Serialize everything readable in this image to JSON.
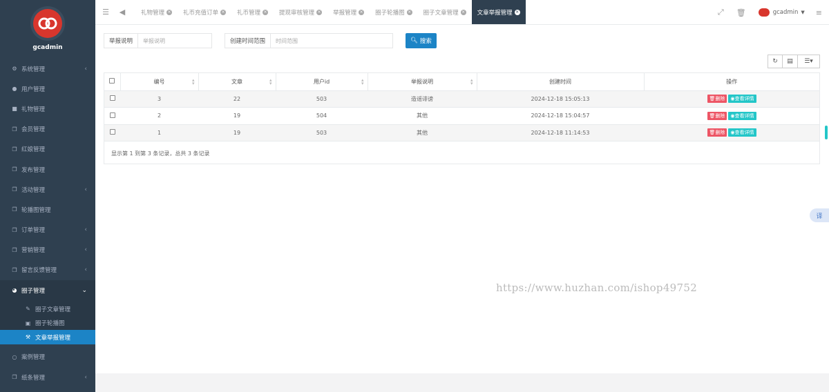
{
  "brand": {
    "name": "gcadmin"
  },
  "sidebar": {
    "items": [
      {
        "label": "系统管理",
        "icon": "gears-icon",
        "arrow": "‹"
      },
      {
        "label": "用户管理",
        "icon": "user-icon",
        "arrow": ""
      },
      {
        "label": "礼物管理",
        "icon": "gift-icon",
        "arrow": ""
      },
      {
        "label": "会员管理",
        "icon": "copy-icon",
        "arrow": ""
      },
      {
        "label": "红娘管理",
        "icon": "copy-icon",
        "arrow": ""
      },
      {
        "label": "发布管理",
        "icon": "copy-icon",
        "arrow": ""
      },
      {
        "label": "活动管理",
        "icon": "copy-icon",
        "arrow": "‹"
      },
      {
        "label": "轮播图管理",
        "icon": "copy-icon",
        "arrow": ""
      },
      {
        "label": "订单管理",
        "icon": "copy-icon",
        "arrow": "‹"
      },
      {
        "label": "营销管理",
        "icon": "copy-icon",
        "arrow": "‹"
      },
      {
        "label": "留言反馈管理",
        "icon": "copy-icon",
        "arrow": "‹"
      }
    ],
    "open_group": {
      "label": "圈子管理",
      "icon": "pie-chart-icon",
      "arrow": "⌄"
    },
    "sub_items": [
      {
        "label": "圈子文章管理",
        "icon": "edit-icon"
      },
      {
        "label": "圈子轮播图",
        "icon": "image-icon"
      },
      {
        "label": "文章举报管理",
        "icon": "gavel-icon"
      }
    ],
    "after_items": [
      {
        "label": "案例管理",
        "icon": "circle-icon",
        "arrow": ""
      },
      {
        "label": "纸条管理",
        "icon": "copy-icon",
        "arrow": "‹"
      }
    ]
  },
  "topbar": {
    "tabs": [
      "礼物管理",
      "礼币充值订单",
      "礼币管理",
      "提现审核管理",
      "举报管理",
      "圈子轮播图",
      "圈子文章管理"
    ],
    "active_tab": "文章举报管理",
    "user_name": "gcadmin"
  },
  "search": {
    "field1_label": "举报说明",
    "field1_placeholder": "举报说明",
    "field2_label": "创建时间范围",
    "field2_placeholder": "时间范围",
    "button_label": "搜索"
  },
  "table": {
    "headers": [
      "编号",
      "文章",
      "用户id",
      "举报说明",
      "创建时间",
      "操作"
    ],
    "rows": [
      {
        "id": "3",
        "article": "22",
        "user_id": "503",
        "reason": "造谣诽谤",
        "created": "2024-12-18 15:05:13"
      },
      {
        "id": "2",
        "article": "19",
        "user_id": "504",
        "reason": "其他",
        "created": "2024-12-18 15:04:57"
      },
      {
        "id": "1",
        "article": "19",
        "user_id": "503",
        "reason": "其他",
        "created": "2024-12-18 11:14:53"
      }
    ],
    "delete_label": "删除",
    "view_label": "查看详情",
    "summary": "显示第 1 到第 3 条记录，总共 3 条记录"
  },
  "watermark": "https://www.huzhan.com/ishop49752",
  "translate_label": "译",
  "colors": {
    "sidebar_bg": "#2f4050",
    "primary": "#1c84c6",
    "danger": "#ed5565",
    "info": "#23c6c8",
    "brand_red": "#d8362d"
  }
}
